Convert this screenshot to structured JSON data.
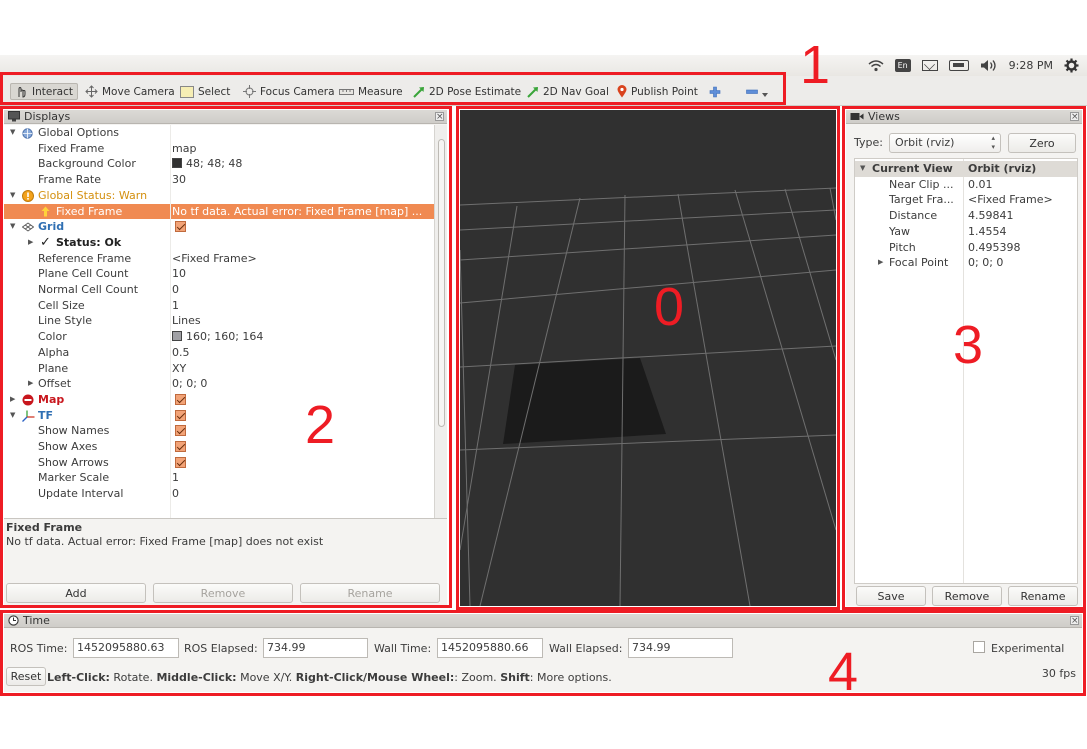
{
  "system_bar": {
    "keyboard_layout": "En",
    "clock": "9:28 PM",
    "icons": [
      "wifi-icon",
      "keyboard-layout-icon",
      "mail-icon",
      "battery-icon",
      "volume-icon",
      "settings-gear-icon"
    ]
  },
  "toolbar": {
    "interact": "Interact",
    "move_camera": "Move Camera",
    "select": "Select",
    "focus_camera": "Focus Camera",
    "measure": "Measure",
    "pose_estimate": "2D Pose Estimate",
    "nav_goal": "2D Nav Goal",
    "publish_point": "Publish Point"
  },
  "displays": {
    "title": "Displays",
    "rows": {
      "global_options": "Global Options",
      "fixed_frame_k": "Fixed Frame",
      "fixed_frame_v": "map",
      "bg_color_k": "Background Color",
      "bg_color_v": "48; 48; 48",
      "frame_rate_k": "Frame Rate",
      "frame_rate_v": "30",
      "global_status": "Global Status: Warn",
      "gs_fixed_frame_k": "Fixed Frame",
      "gs_fixed_frame_v": "No tf data.  Actual error: Fixed Frame [map] ...",
      "grid": "Grid",
      "status_ok": "Status: Ok",
      "ref_frame_k": "Reference Frame",
      "ref_frame_v": "<Fixed Frame>",
      "plane_cell_count_k": "Plane Cell Count",
      "plane_cell_count_v": "10",
      "normal_cell_count_k": "Normal Cell Count",
      "normal_cell_count_v": "0",
      "cell_size_k": "Cell Size",
      "cell_size_v": "1",
      "line_style_k": "Line Style",
      "line_style_v": "Lines",
      "color_k": "Color",
      "color_v": "160; 160; 164",
      "alpha_k": "Alpha",
      "alpha_v": "0.5",
      "plane_k": "Plane",
      "plane_v": "XY",
      "offset_k": "Offset",
      "offset_v": "0; 0; 0",
      "map": "Map",
      "tf": "TF",
      "show_names": "Show Names",
      "show_axes": "Show Axes",
      "show_arrows": "Show Arrows",
      "marker_scale_k": "Marker Scale",
      "marker_scale_v": "1",
      "update_interval_k": "Update Interval",
      "update_interval_v": "0"
    },
    "description_title": "Fixed Frame",
    "description_text": "No tf data. Actual error: Fixed Frame [map] does not exist",
    "buttons": {
      "add": "Add",
      "remove": "Remove",
      "rename": "Rename"
    }
  },
  "views": {
    "title": "Views",
    "type_label": "Type:",
    "type_value": "Orbit (rviz)",
    "zero": "Zero",
    "current_view_k": "Current View",
    "current_view_v": "Orbit (rviz)",
    "near_clip_k": "Near Clip ...",
    "near_clip_v": "0.01",
    "target_frame_k": "Target Fra...",
    "target_frame_v": "<Fixed Frame>",
    "distance_k": "Distance",
    "distance_v": "4.59841",
    "yaw_k": "Yaw",
    "yaw_v": "1.4554",
    "pitch_k": "Pitch",
    "pitch_v": "0.495398",
    "focal_point_k": "Focal Point",
    "focal_point_v": "0; 0; 0",
    "buttons": {
      "save": "Save",
      "remove": "Remove",
      "rename": "Rename"
    }
  },
  "time": {
    "title": "Time",
    "ros_time_label": "ROS Time:",
    "ros_time": "1452095880.63",
    "ros_elapsed_label": "ROS Elapsed:",
    "ros_elapsed": "734.99",
    "wall_time_label": "Wall Time:",
    "wall_time": "1452095880.66",
    "wall_elapsed_label": "Wall Elapsed:",
    "wall_elapsed": "734.99",
    "experimental": "Experimental",
    "reset": "Reset",
    "status": {
      "lc": "Left-Click:",
      "lc_t": " Rotate. ",
      "mc": "Middle-Click:",
      "mc_t": " Move X/Y. ",
      "rc": "Right-Click/Mouse Wheel:",
      "rc_t": ": Zoom. ",
      "sh": "Shift",
      "sh_t": ": More options."
    },
    "fps": "30 fps"
  },
  "annotations": {
    "n0": "0",
    "n1": "1",
    "n2": "2",
    "n3": "3",
    "n4": "4"
  },
  "colors": {
    "annotation_red": "#ee1c24",
    "selection_orange": "#f08a52",
    "viewport_bg": "#303030"
  }
}
